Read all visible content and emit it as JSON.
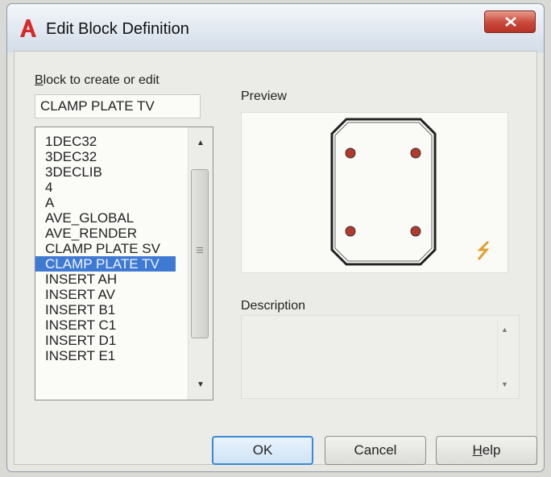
{
  "window": {
    "title": "Edit Block Definition",
    "close_glyph": "✕"
  },
  "block_section": {
    "label_first": "B",
    "label_rest": "lock to create or edit",
    "current_name": "CLAMP PLATE TV",
    "items": [
      "1DEC32",
      "3DEC32",
      "3DECLIB",
      "4",
      "A",
      "AVE_GLOBAL",
      "AVE_RENDER",
      "CLAMP PLATE SV",
      "CLAMP PLATE TV",
      "INSERT AH",
      "INSERT AV",
      "INSERT B1",
      "INSERT C1",
      "INSERT D1",
      "INSERT E1"
    ],
    "selected_index": 8
  },
  "preview": {
    "label": "Preview",
    "shape_color": "#222222",
    "hole_color": "#b23a2a",
    "annotative_icon_color": "#e0a030"
  },
  "description": {
    "label": "Description",
    "value": ""
  },
  "buttons": {
    "ok": "OK",
    "cancel": "Cancel",
    "help_first": "H",
    "help_rest": "elp"
  },
  "colors": {
    "selection": "#3f7ad2",
    "close_button": "#c8483a",
    "app_logo": "#d42a2a"
  }
}
